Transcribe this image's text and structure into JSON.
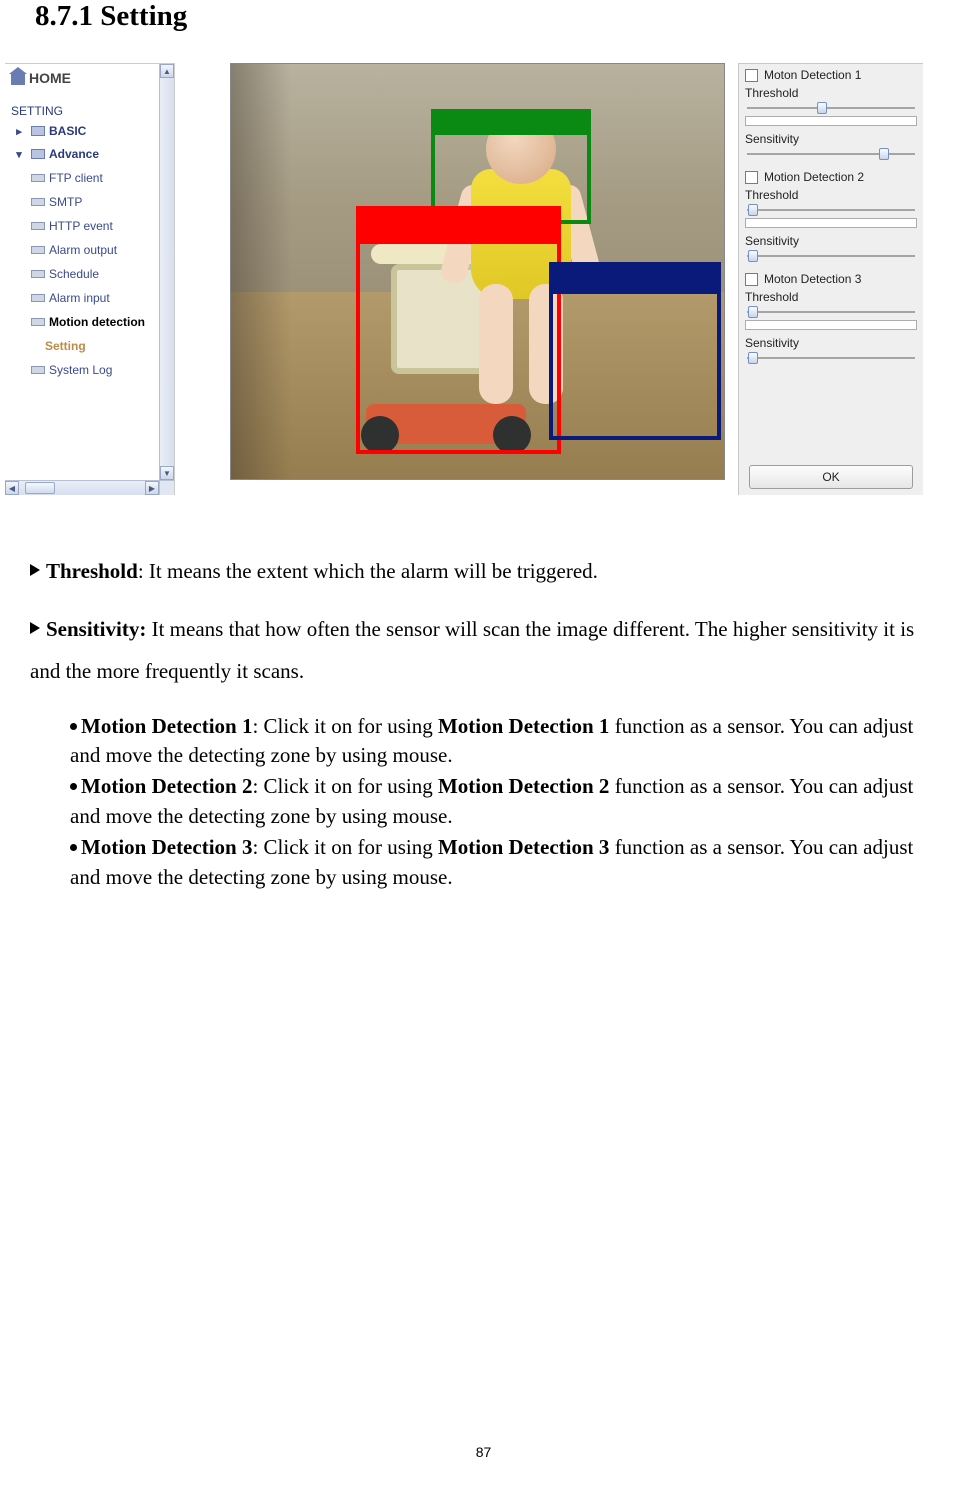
{
  "heading": "8.7.1 Setting",
  "sidebar": {
    "home": "HOME",
    "section": "SETTING",
    "basic": "BASIC",
    "advance": "Advance",
    "items": {
      "ftp": "FTP client",
      "smtp": "SMTP",
      "http": "HTTP event",
      "alarmout": "Alarm output",
      "schedule": "Schedule",
      "alarmin": "Alarm input",
      "motion": "Motion detection",
      "setting": "Setting",
      "syslog": "System Log"
    }
  },
  "panel": {
    "groups": [
      {
        "title": "Moton Detection 1",
        "threshold": "Threshold",
        "sensitivity": "Sensitivity",
        "thumb1": 42,
        "thumb2": 78,
        "ticks": false
      },
      {
        "title": "Motion Detection 2",
        "threshold": "Threshold",
        "sensitivity": "Sensitivity",
        "thumb1": 2,
        "thumb2": 2,
        "ticks": true
      },
      {
        "title": "Moton Detection 3",
        "threshold": "Threshold",
        "sensitivity": "Sensitivity",
        "thumb1": 2,
        "thumb2": 2,
        "ticks": true
      }
    ],
    "ok": "OK"
  },
  "text": {
    "threshold_label": "Threshold",
    "threshold_desc": ": It means the extent which the alarm will be triggered.",
    "sensitivity_label": "Sensitivity:",
    "sensitivity_desc": " It means that how often the sensor will scan the image different. The higher sensitivity it is and the more frequently it scans.",
    "md1_a": "Motion Detection 1",
    "md1_b": ": Click it on for using ",
    "md1_c": "Motion Detection 1",
    "md1_d": " function as a sensor. You can adjust and move the detecting zone by using mouse.",
    "md2_a": "Motion Detection 2",
    "md2_b": ": Click it on for using ",
    "md2_c": "Motion Detection 2",
    "md2_d": " function as a sensor. You can adjust and move the detecting zone by using mouse.",
    "md3_a": "Motion Detection 3",
    "md3_b": ": Click it on for using ",
    "md3_c": "Motion Detection 3",
    "md3_d": " function as a sensor. You can adjust and move the detecting zone by using mouse."
  },
  "pageNumber": "87"
}
